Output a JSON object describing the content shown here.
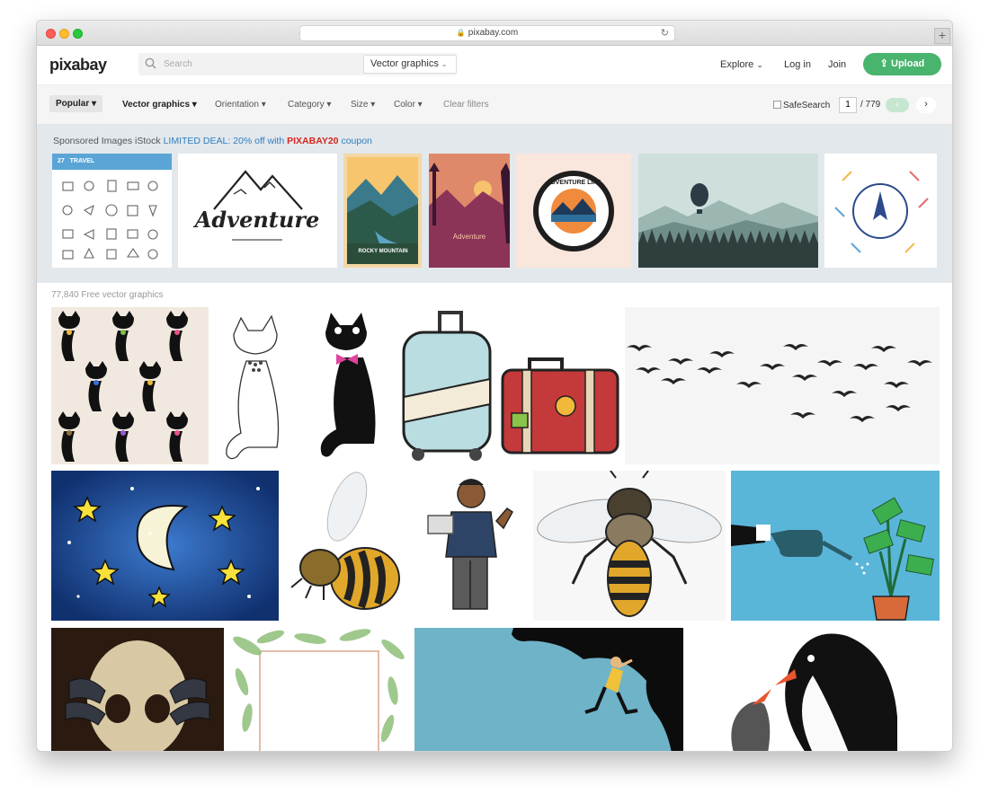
{
  "browser": {
    "url": "pixabay.com"
  },
  "header": {
    "logo": "pixabay",
    "search_placeholder": "Search",
    "search_type": "Vector graphics",
    "explore": "Explore",
    "login": "Log in",
    "join": "Join",
    "upload": "Upload",
    "accent_color": "#48b46e"
  },
  "filters": {
    "popular": "Popular",
    "vector_graphics": "Vector graphics",
    "orientation": "Orientation",
    "category": "Category",
    "size": "Size",
    "color": "Color",
    "clear": "Clear filters",
    "safesearch": "SafeSearch",
    "page": "1",
    "page_total": "/ 779"
  },
  "sponsored": {
    "prefix": "Sponsored Images iStock",
    "deal": "LIMITED DEAL: 20% off with",
    "code": "PIXABAY20",
    "suffix": "coupon",
    "items": [
      {
        "name": "travel-icons",
        "caption": "TRAVEL",
        "badge": "27"
      },
      {
        "name": "adventure-begins-lettering",
        "caption": "Adventure"
      },
      {
        "name": "rocky-mountain-poster",
        "caption": "ROCKY MOUNTAIN"
      },
      {
        "name": "adventure-sunset-poster",
        "caption": "Adventure"
      },
      {
        "name": "adventure-life-badge",
        "caption": "ADVENTURE LIFE"
      },
      {
        "name": "balloon-landscape"
      },
      {
        "name": "compass-graphic"
      }
    ]
  },
  "results": {
    "count_label": "77,840 Free vector graphics"
  }
}
